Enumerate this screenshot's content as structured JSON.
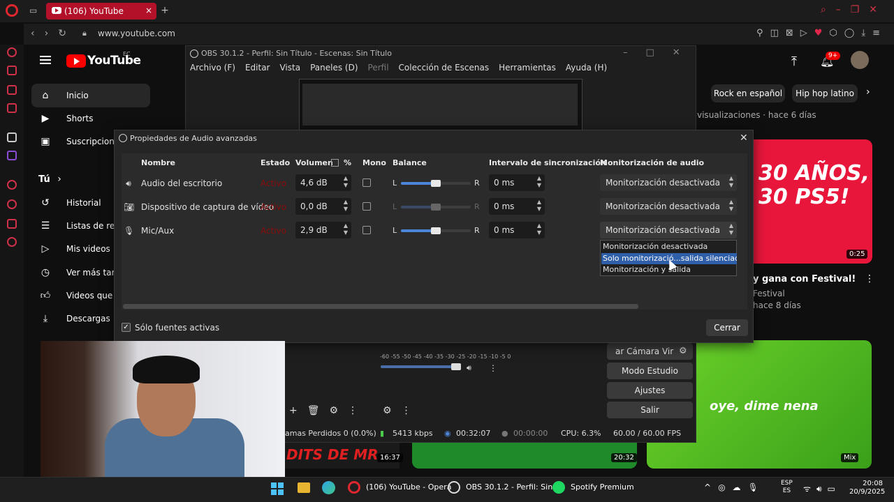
{
  "browser": {
    "tab_title": "(106) YouTube",
    "url": "www.youtube.com"
  },
  "youtube": {
    "logo_text": "YouTube",
    "region": "EC",
    "notifications": "9+",
    "sidebar": [
      {
        "label": "Inicio",
        "icon": "home-icon"
      },
      {
        "label": "Shorts",
        "icon": "shorts-icon"
      },
      {
        "label": "Suscripciones",
        "icon": "subscriptions-icon"
      },
      {
        "label": "Tú",
        "icon": "chevron-right-icon"
      },
      {
        "label": "Historial",
        "icon": "history-icon"
      },
      {
        "label": "Listas de repr",
        "icon": "playlist-icon"
      },
      {
        "label": "Mis videos",
        "icon": "video-icon"
      },
      {
        "label": "Ver más tard",
        "icon": "clock-icon"
      },
      {
        "label": "Videos que m",
        "icon": "like-icon"
      },
      {
        "label": "Descargas",
        "icon": "download-icon"
      }
    ],
    "chips": [
      "Rock en español",
      "Hip hop latino"
    ],
    "video_meta_1": "visualizaciones · hace 6 días",
    "thumb1_text": "30 AÑOS, 30 PS5!",
    "thumb1_line1": "30 AÑOS,",
    "thumb1_line2": "30 PS5!",
    "thumb1_duration": "0:25",
    "video2_title": "y gana con Festival!",
    "video2_channel": "Festival",
    "video2_meta": "hace 8 días",
    "thumb2_text": "oye, dime nena",
    "thumb2_badge": "Mix",
    "thumb3_duration": "20:32",
    "thumb4_text": "DITS DE MR",
    "thumb4_duration": "16:37"
  },
  "obs": {
    "title": "OBS 30.1.2 - Perfil: Sin Título - Escenas: Sin Título",
    "menu": [
      "Archivo (F)",
      "Editar",
      "Vista",
      "Paneles (D)",
      "Perfil",
      "Colección de Escenas",
      "Herramientas",
      "Ayuda (H)"
    ],
    "mixer_scale": "-60 -55 -50 -45 -40 -35 -30 -25 -20 -15 -10 -5 0",
    "buttons": [
      "ar Cámara Vir",
      "Modo Estudio",
      "Ajustes",
      "Salir"
    ],
    "status": {
      "dropped": "amas Perdidos 0 (0.0%)",
      "bitrate": "5413 kbps",
      "stream_time": "00:32:07",
      "rec_time": "00:00:00",
      "cpu": "CPU: 6.3%",
      "fps": "60.00 / 60.00 FPS"
    }
  },
  "dialog": {
    "title": "Propiedades de Audio avanzadas",
    "headers": {
      "name": "Nombre",
      "state": "Estado",
      "volume": "Volumen",
      "percent": "%",
      "mono": "Mono",
      "balance": "Balance",
      "sync": "Intervalo de sincronización",
      "monitoring": "Monitorización de audio"
    },
    "balance_left": "L",
    "balance_right": "R",
    "rows": [
      {
        "icon": "speaker-icon",
        "name": "Audio del escritorio",
        "state": "Activo",
        "volume": "4,6 dB",
        "mono": false,
        "balance": 0.5,
        "sync": "0 ms",
        "monitoring": "Monitorización desactivada"
      },
      {
        "icon": "camera-icon",
        "name": "Dispositivo de captura de vídeo",
        "state": "Activo",
        "volume": "0,0 dB",
        "mono": false,
        "balance": 0.5,
        "sync": "0 ms",
        "monitoring": "Monitorización desactivada"
      },
      {
        "icon": "microphone-icon",
        "name": "Mic/Aux",
        "state": "Activo",
        "volume": "2,9 dB",
        "mono": false,
        "balance": 0.5,
        "sync": "0 ms",
        "monitoring": "Monitorización desactivada"
      }
    ],
    "dropdown_options": [
      "Monitorización desactivada",
      "Solo monitorizació...salida silenciada)",
      "Monitorización y salida"
    ],
    "dropdown_selected_index": 1,
    "active_only_label": "Sólo fuentes activas",
    "close_label": "Cerrar"
  },
  "taskbar": {
    "apps": [
      "(106) YouTube - Opera",
      "OBS 30.1.2 - Perfil: Sin Tí",
      "Spotify Premium"
    ],
    "lang_line1": "ESP",
    "lang_line2": "ES",
    "time": "20:08",
    "date": "20/9/2025"
  }
}
